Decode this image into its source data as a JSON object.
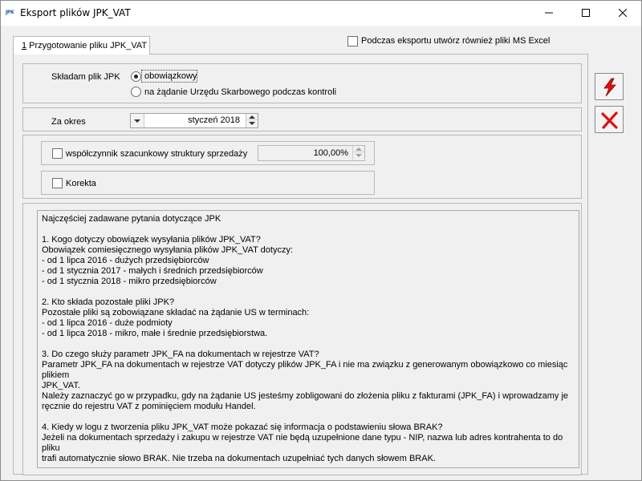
{
  "window": {
    "app_icon": "JPK",
    "title": "Eksport plików JPK_VAT",
    "controls": [
      "minimize-icon",
      "maximize-icon",
      "close-icon"
    ]
  },
  "tab": {
    "label_underlined": "1",
    "label_rest": " Przygotowanie pliku JPK_VAT"
  },
  "excel_option": {
    "label": "Podczas eksportu utwórz również pliki MS Excel",
    "checked": false
  },
  "filing": {
    "label": "Składam plik JPK",
    "options": [
      "obowiązkowy",
      "na żądanie Urzędu Skarbowego podczas kontroli"
    ],
    "selected": "obowiązkowy"
  },
  "period": {
    "label": "Za okres",
    "value": "styczeń 2018"
  },
  "coefficient": {
    "label": "współczynnik szacunkowy struktury sprzedaży",
    "checked": false,
    "value": "100,00%"
  },
  "correction": {
    "label": "Korekta",
    "checked": false
  },
  "faq": {
    "lines": [
      "Najczęściej zadawane pytania dotyczące JPK",
      "",
      "1. Kogo dotyczy obowiązek wysyłania plików JPK_VAT?",
      "Obowiązek comiesięcznego wysyłania plików JPK_VAT dotyczy:",
      "- od 1 lipca 2016 - dużych przedsiębiorców",
      "- od 1 stycznia 2017 - małych i średnich przedsiębiorców",
      "- od 1 stycznia 2018 - mikro przedsiębiorców",
      "",
      "2. Kto składa pozostałe pliki JPK?",
      "Pozostałe pliki są zobowiązane składać na żądanie US w terminach:",
      "- od 1 lipca 2016 - duże podmioty",
      "- od 1 lipca 2018 - mikro, małe i średnie przedsiębiorstwa.",
      "",
      "3. Do czego służy parametr JPK_FA na dokumentach w rejestrze VAT?",
      "Parametr JPK_FA na dokumentach w rejestrze VAT dotyczy plików JPK_FA i nie ma związku z generowanym obowiązkowo co miesiąc plikiem",
      "JPK_VAT.",
      "Należy zaznaczyć go w przypadku, gdy na żądanie US jesteśmy zobligowani do złożenia pliku z fakturami (JPK_FA) i wprowadzamy je",
      "ręcznie do rejestru VAT z pominięciem modułu Handel.",
      "",
      "4. Kiedy w logu z tworzenia pliku JPK_VAT może pokazać się informacja o podstawieniu słowa BRAK?",
      "Jeżeli na dokumentach sprzedaży i zakupu w rejestrze VAT nie będą uzupełnione dane typu - NIP, nazwa lub adres kontrahenta to do pliku",
      "trafi automatycznie słowo BRAK. Nie trzeba na dokumentach uzupełniać tych danych słowem BRAK."
    ]
  },
  "side_buttons": {
    "export_icon": "lightning-icon",
    "cancel_icon": "red-x-icon"
  },
  "colors": {
    "accent_red": "#e01010",
    "background": "#f0f0f0"
  }
}
